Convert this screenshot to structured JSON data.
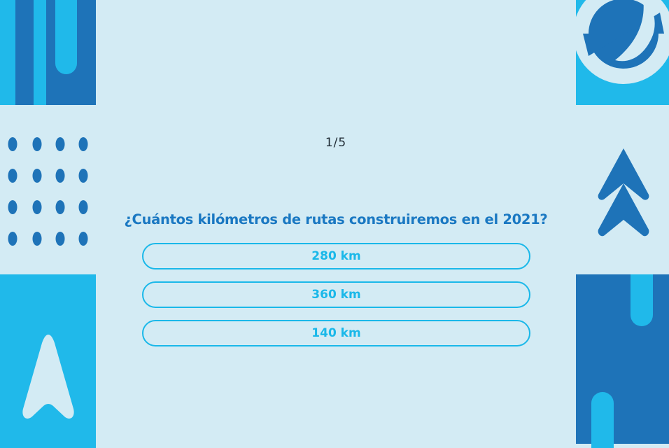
{
  "quiz": {
    "counter": "1/5",
    "question": "¿Cuántos kilómetros de rutas construiremos en el 2021?",
    "options": [
      {
        "label": "280 km"
      },
      {
        "label": "360 km"
      },
      {
        "label": "140 km"
      }
    ]
  },
  "decor": {
    "left_top": "vertical-bars-pattern",
    "left_middle": "dot-grid-pattern",
    "left_bottom": "arrow-up-icon",
    "right_top": "ring-circle-pattern",
    "right_middle": "double-chevron-up-icon",
    "right_bottom": "rounded-bars-pattern"
  },
  "colors": {
    "background": "#d3ebf4",
    "dark_blue": "#1e73b8",
    "light_blue": "#20b9ea",
    "pale": "#d3ebf4",
    "question_text": "#1a78c2",
    "option_accent": "#1ab8e9"
  }
}
